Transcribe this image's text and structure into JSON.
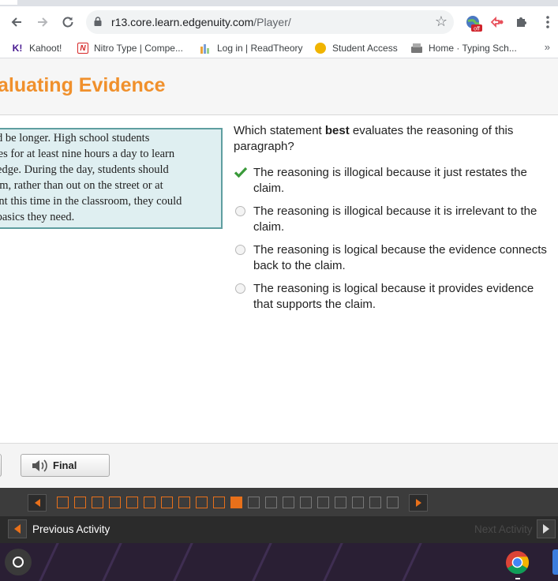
{
  "browser": {
    "url_host": "r13.core.learn.edgenuity.com",
    "url_path": "/Player/",
    "ext_badge": "off"
  },
  "bookmarks": [
    {
      "label": "Kahoot!",
      "icon": "kahoot-icon",
      "glyph": "K!",
      "color": "#46178f"
    },
    {
      "label": "Nitro Type | Compe...",
      "icon": "nitro-type-icon",
      "glyph": "N",
      "color": "#d62828"
    },
    {
      "label": "Log in | ReadTheory",
      "icon": "readtheory-icon",
      "glyph": "",
      "color": "#e8a33a"
    },
    {
      "label": "Student Access",
      "icon": "student-access-icon",
      "glyph": "",
      "color": "#f0b400"
    },
    {
      "label": "Home · Typing Sch...",
      "icon": "typing-icon",
      "glyph": "",
      "color": "#777777"
    }
  ],
  "page": {
    "title": "aluating Evidence"
  },
  "passage": {
    "lines": [
      "ld be longer. High school students",
      "ses for at least nine hours a day to learn",
      "ledge. During the day, students should",
      "om, rather than out on the street or at",
      "ent this time in the classroom, they could",
      " basics they need."
    ]
  },
  "question": {
    "before": "Which statement ",
    "emphasis": "best",
    "after": " evaluates the reasoning of this paragraph?"
  },
  "options": [
    {
      "text": "The reasoning is illogical because it just restates the claim.",
      "selected": true
    },
    {
      "text": "The reasoning is illogical because it is irrelevant to the claim.",
      "selected": false
    },
    {
      "text": "The reasoning is logical because the evidence connects back to the claim.",
      "selected": false
    },
    {
      "text": "The reasoning is logical because it provides evidence that supports the claim.",
      "selected": false
    }
  ],
  "footer": {
    "final_label": "Final"
  },
  "progress": {
    "total": 20,
    "completed": 10,
    "current_index": 10
  },
  "activity_nav": {
    "previous_label": "Previous Activity",
    "next_label": "Next Activity"
  },
  "colors": {
    "accent": "#e8701a",
    "title": "#f0902c",
    "check": "#3a9a3a",
    "passage_bg": "#dfeff1",
    "passage_border": "#5f9ea0"
  }
}
